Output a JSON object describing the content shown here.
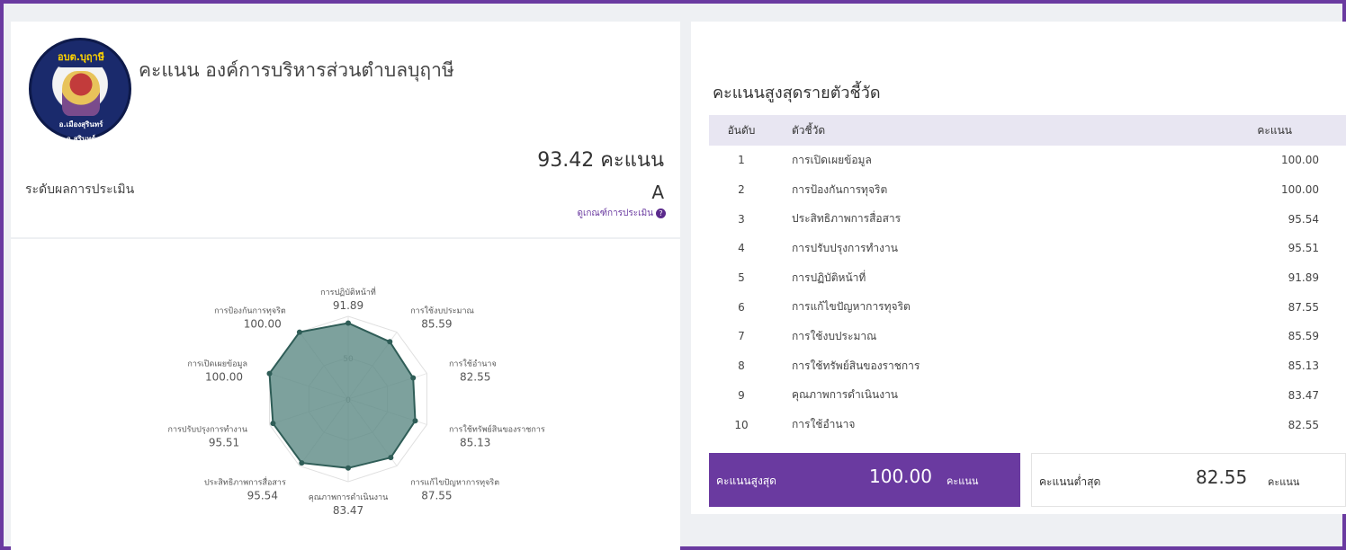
{
  "header": {
    "org_title": "คะแนน องค์การบริหารส่วนตำบลบุฤาษี",
    "logo_text_top": "อบต.บุฤาษี",
    "logo_text_bottom": "อ.เมืองสุรินทร์ จ.สุรินทร์",
    "total_score": "93.42 คะแนน",
    "level_label": "ระดับผลการประเมิน",
    "grade": "A",
    "criteria_link": "ดูเกณฑ์การประเมิน"
  },
  "radar": {
    "scale_labels": [
      "0",
      "50"
    ],
    "axes": [
      {
        "label": "การปฏิบัติหน้าที่",
        "value": "91.89",
        "v": 91.89
      },
      {
        "label": "การใช้งบประมาณ",
        "value": "85.59",
        "v": 85.59
      },
      {
        "label": "การใช้อำนาจ",
        "value": "82.55",
        "v": 82.55
      },
      {
        "label": "การใช้ทรัพย์สินของราชการ",
        "value": "85.13",
        "v": 85.13
      },
      {
        "label": "การแก้ไขปัญหาการทุจริต",
        "value": "87.55",
        "v": 87.55
      },
      {
        "label": "คุณภาพการดำเนินงาน",
        "value": "83.47",
        "v": 83.47
      },
      {
        "label": "ประสิทธิภาพการสื่อสาร",
        "value": "95.54",
        "v": 95.54
      },
      {
        "label": "การปรับปรุงการทำงาน",
        "value": "95.51",
        "v": 95.51
      },
      {
        "label": "การเปิดเผยข้อมูล",
        "value": "100.00",
        "v": 100.0
      },
      {
        "label": "การป้องกันการทุจริต",
        "value": "100.00",
        "v": 100.0
      }
    ],
    "fill_color": "#5d8a85",
    "stroke_color": "#2f5d57"
  },
  "ranking": {
    "title": "คะแนนสูงสุดรายตัวชี้วัด",
    "headers": {
      "rank": "อันดับ",
      "name": "ตัวชี้วัด",
      "score": "คะแนน"
    },
    "rows": [
      {
        "rank": "1",
        "name": "การเปิดเผยข้อมูล",
        "score": "100.00"
      },
      {
        "rank": "2",
        "name": "การป้องกันการทุจริต",
        "score": "100.00"
      },
      {
        "rank": "3",
        "name": "ประสิทธิภาพการสื่อสาร",
        "score": "95.54"
      },
      {
        "rank": "4",
        "name": "การปรับปรุงการทำงาน",
        "score": "95.51"
      },
      {
        "rank": "5",
        "name": "การปฏิบัติหน้าที่",
        "score": "91.89"
      },
      {
        "rank": "6",
        "name": "การแก้ไขปัญหาการทุจริต",
        "score": "87.55"
      },
      {
        "rank": "7",
        "name": "การใช้งบประมาณ",
        "score": "85.59"
      },
      {
        "rank": "8",
        "name": "การใช้ทรัพย์สินของราชการ",
        "score": "85.13"
      },
      {
        "rank": "9",
        "name": "คุณภาพการดำเนินงาน",
        "score": "83.47"
      },
      {
        "rank": "10",
        "name": "การใช้อำนาจ",
        "score": "82.55"
      }
    ]
  },
  "summary": {
    "max_label": "คะแนนสูงสุด",
    "max_value": "100.00",
    "max_unit": "คะแนน",
    "min_label": "คะแนนต่ำสุด",
    "min_value": "82.55",
    "min_unit": "คะแนน"
  },
  "colors": {
    "accent": "#6a3aa0",
    "table_header": "#e8e6f2"
  }
}
